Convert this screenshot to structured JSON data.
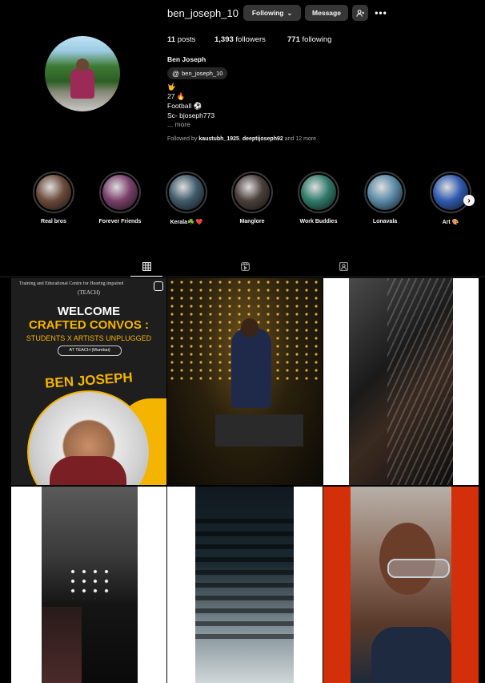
{
  "profile": {
    "username": "ben_joseph_10",
    "following_btn": "Following",
    "message_btn": "Message",
    "posts_count": "11",
    "posts_label": "posts",
    "followers_count": "1,393",
    "followers_label": "followers",
    "following_count": "771",
    "following_label": "following",
    "full_name": "Ben Joseph",
    "threads_handle": "ben_joseph_10",
    "bio_line1": "🤟",
    "bio_line2": "27 🔥",
    "bio_line3": "Football ⚽",
    "bio_line4": "Sc- bjoseph773",
    "bio_more": "... more",
    "followed_by_prefix": "Followed by",
    "followed_by_user1": "kaustubh_1925",
    "followed_by_sep": ",",
    "followed_by_user2": "deeptijoseph92",
    "followed_by_suffix": "and 12 more"
  },
  "highlights": [
    {
      "label": "Real bros",
      "color": "#6b4a3a"
    },
    {
      "label": "Forever Friends",
      "color": "#7a3f6a"
    },
    {
      "label": "Kerala☘️ ❤️",
      "color": "#3f5a6a"
    },
    {
      "label": "Manglore",
      "color": "#4a3f3a"
    },
    {
      "label": "Work Buddies",
      "color": "#2f7a6a"
    },
    {
      "label": "Lonavala",
      "color": "#5a8aa8"
    },
    {
      "label": "Art 🎨",
      "color": "#2f5ab0"
    }
  ],
  "posts": {
    "p1_header": "Training and Educational Centre for Hearing impaired",
    "p1_teach": "(TEACH)",
    "p1_welcome": "WELCOME",
    "p1_crafted": "CRAFTED CONVOS :",
    "p1_sub": "STUDENTS X ARTISTS UNPLUGGED",
    "p1_loc": "AT TEACH (Mumbai)",
    "p1_name": "BEN JOSEPH"
  },
  "icons": {
    "grid": "grid-icon",
    "reels": "reels-icon",
    "tagged": "tagged-icon"
  }
}
